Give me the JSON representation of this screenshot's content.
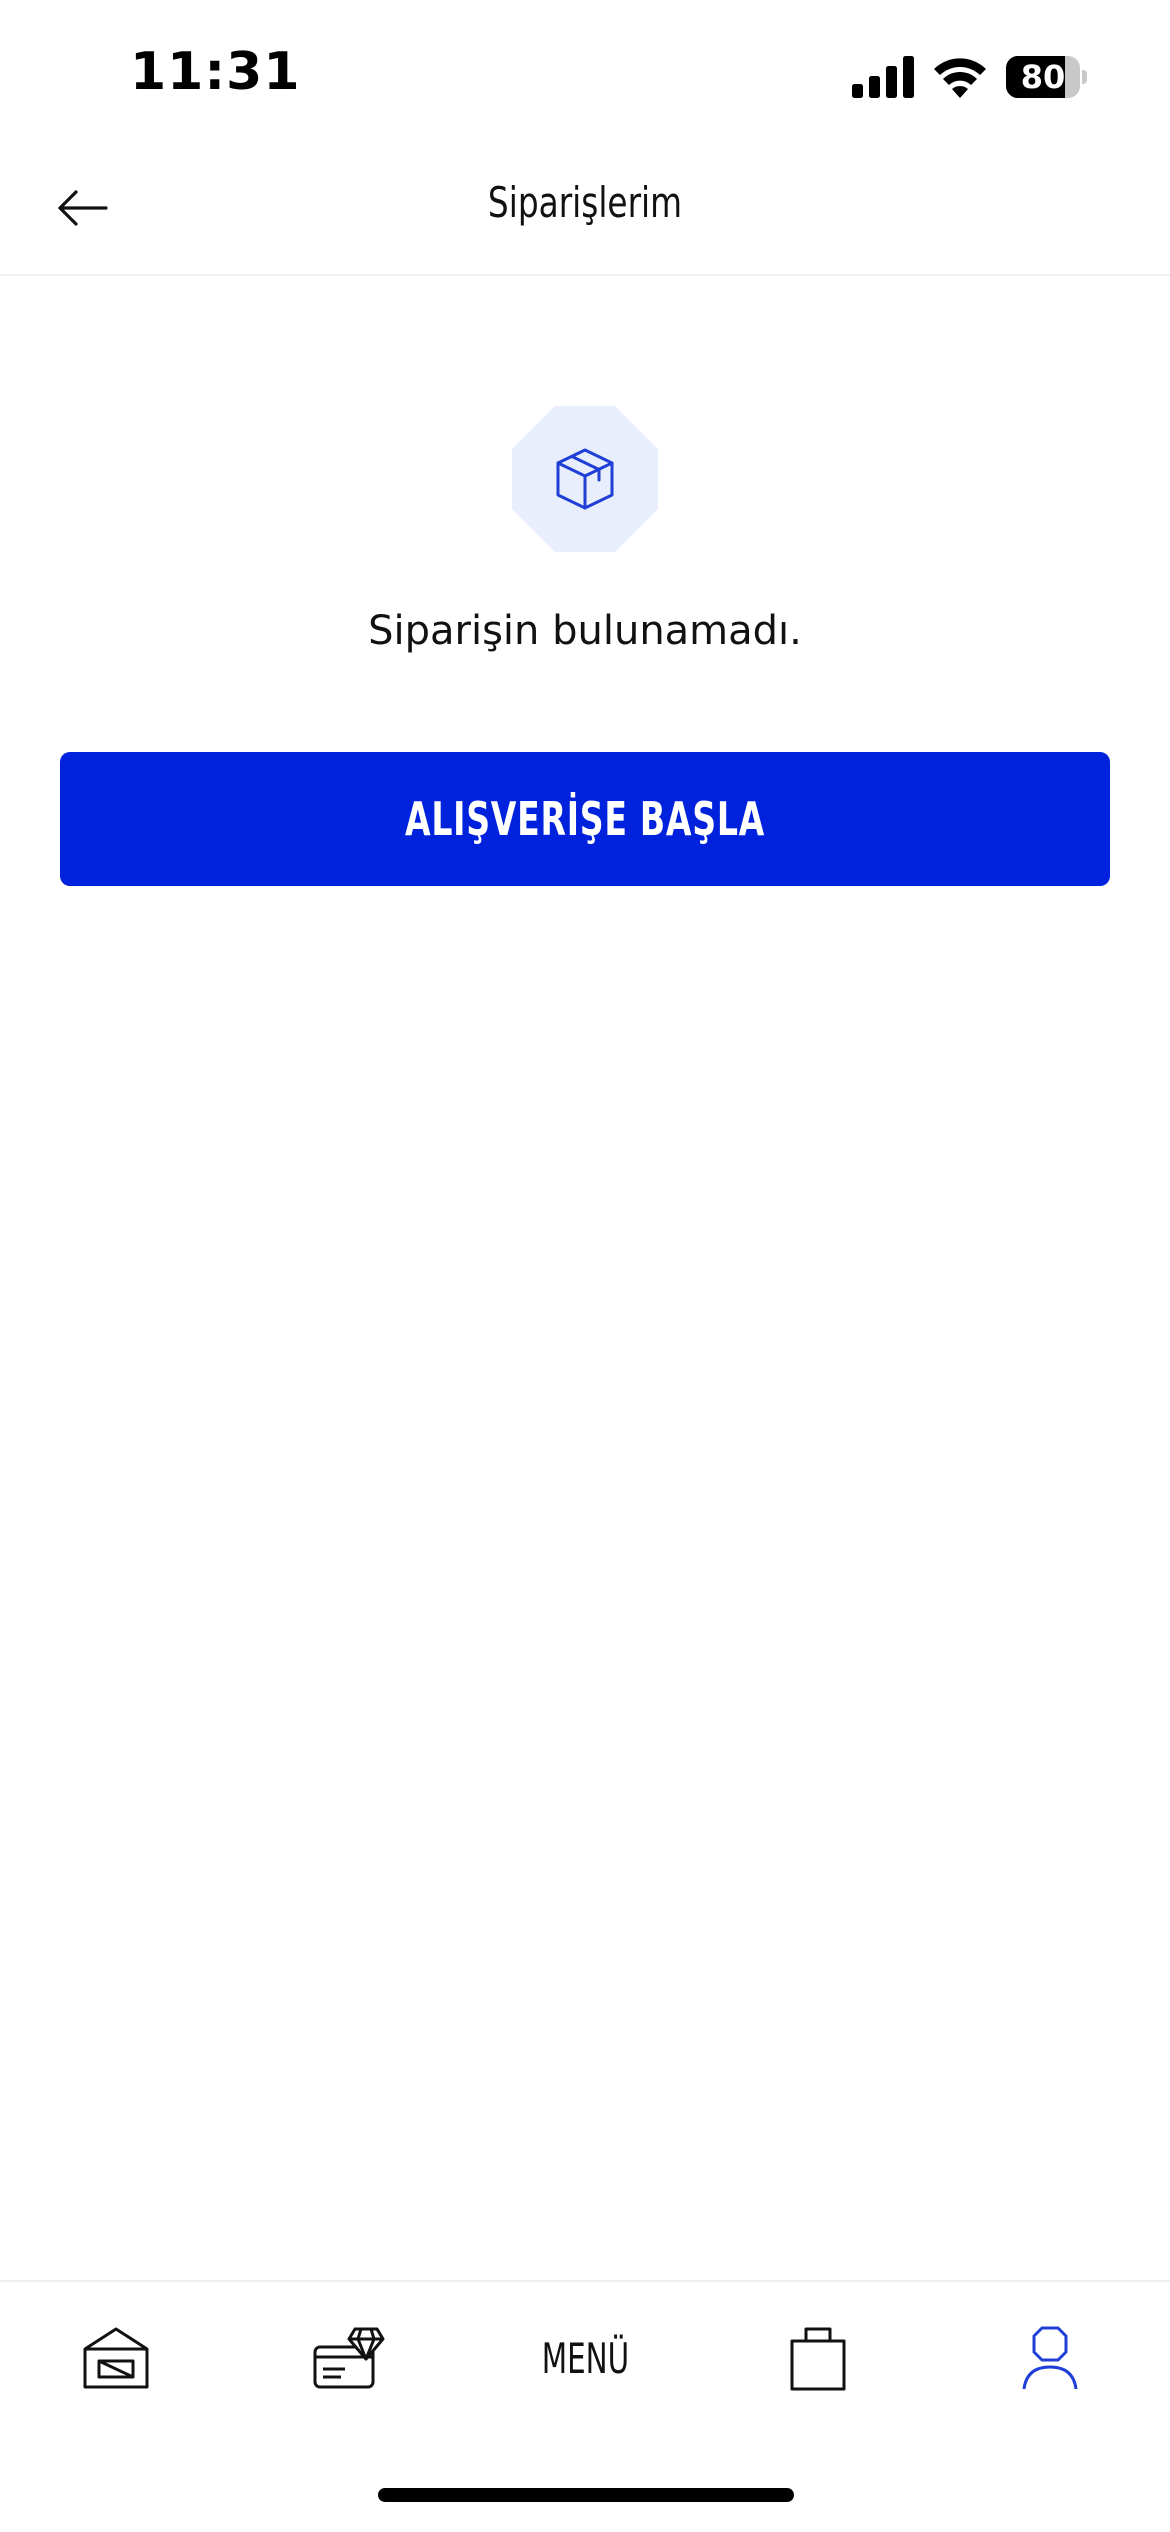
{
  "status_bar": {
    "time": "11:31",
    "battery_level": "80",
    "battery_fraction": 0.8
  },
  "header": {
    "title": "Siparişlerim",
    "back_icon": "arrow-left-icon"
  },
  "empty_state": {
    "icon": "package-box-icon",
    "message": "Siparişin bulunamadı.",
    "button_label": "ALIŞVERİŞE BAŞLA"
  },
  "tab_bar": {
    "items": [
      {
        "id": "home",
        "icon": "home-store-icon"
      },
      {
        "id": "gift-card",
        "icon": "gift-card-icon"
      },
      {
        "id": "menu",
        "label": "MENÜ"
      },
      {
        "id": "cart",
        "icon": "shopping-bag-icon"
      },
      {
        "id": "profile",
        "icon": "user-icon",
        "active": true
      }
    ]
  },
  "colors": {
    "accent": "#0022DD",
    "icon_background": "#E8EEFB",
    "text": "#111111",
    "active_tab": "#1F3FD6"
  }
}
